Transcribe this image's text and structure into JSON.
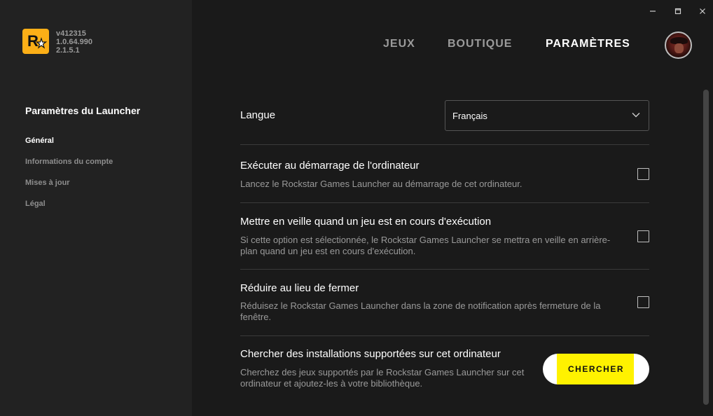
{
  "sidebar": {
    "versions": [
      "v412315",
      "1.0.64.990",
      "2.1.5.1"
    ],
    "title": "Paramètres du Launcher",
    "items": [
      {
        "label": "Général",
        "active": true
      },
      {
        "label": "Informations du compte"
      },
      {
        "label": "Mises à jour"
      },
      {
        "label": "Légal"
      }
    ]
  },
  "nav": {
    "jeux": "JEUX",
    "boutique": "BOUTIQUE",
    "parametres": "PARAMÈTRES"
  },
  "settings": {
    "language": {
      "label": "Langue",
      "value": "Français"
    },
    "startup": {
      "title": "Exécuter au démarrage de l'ordinateur",
      "desc": "Lancez le Rockstar Games Launcher au démarrage de cet ordinateur.",
      "checked": false
    },
    "sleep": {
      "title": "Mettre en veille quand un jeu est en cours d'exécution",
      "desc": "Si cette option est sélectionnée, le Rockstar Games Launcher se mettra en veille en arrière-plan quand un jeu est en cours d'exécution.",
      "checked": false
    },
    "minimize": {
      "title": "Réduire au lieu de fermer",
      "desc": "Réduisez le Rockstar Games Launcher dans la zone de notification après fermeture de la fenêtre.",
      "checked": false
    },
    "scan": {
      "title": "Chercher des installations supportées sur cet ordinateur",
      "desc": "Cherchez des jeux supportés par le Rockstar Games Launcher sur cet ordinateur et ajoutez-les à votre bibliothèque.",
      "button": "CHERCHER"
    }
  },
  "icons": {
    "logo": "rockstar-logo-icon",
    "minimize": "minimize-icon",
    "maximize": "maximize-icon",
    "close": "close-icon",
    "chevron": "chevron-down-icon",
    "avatar": "avatar"
  },
  "colors": {
    "accent": "#fcaf17",
    "button": "#fff200",
    "sidebar": "#222222",
    "background": "#1a1a1a"
  }
}
